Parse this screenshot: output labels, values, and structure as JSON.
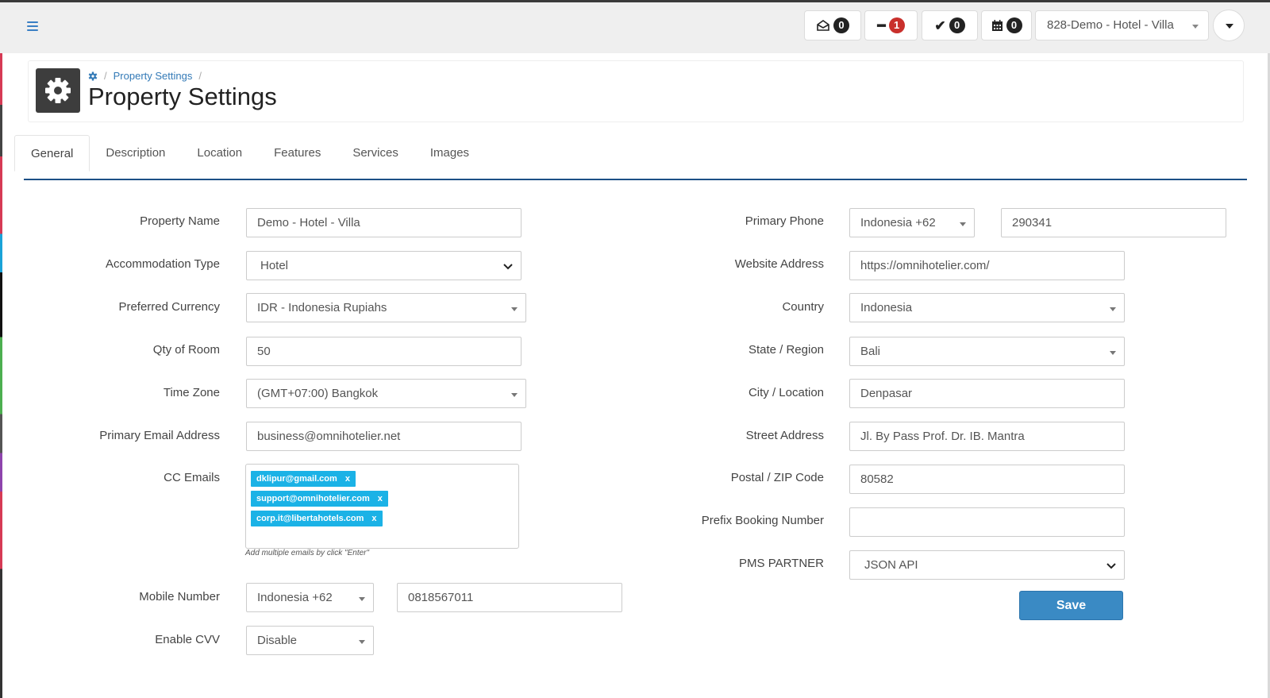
{
  "topbar": {
    "messages_count": "0",
    "minus_count": "1",
    "check_count": "0",
    "calendar_count": "0",
    "property_selector": "828-Demo - Hotel - Villa"
  },
  "breadcrumb": {
    "item": "Property Settings"
  },
  "page": {
    "title": "Property Settings"
  },
  "tabs": [
    "General",
    "Description",
    "Location",
    "Features",
    "Services",
    "Images"
  ],
  "left_form": {
    "property_name": {
      "label": "Property Name",
      "value": "Demo - Hotel - Villa"
    },
    "accommodation_type": {
      "label": "Accommodation Type",
      "value": "Hotel"
    },
    "preferred_currency": {
      "label": "Preferred Currency",
      "value": "IDR - Indonesia Rupiahs"
    },
    "qty_of_room": {
      "label": "Qty of Room",
      "value": "50"
    },
    "time_zone": {
      "label": "Time Zone",
      "value": "(GMT+07:00) Bangkok"
    },
    "primary_email": {
      "label": "Primary Email Address",
      "value": "business@omnihotelier.net"
    },
    "cc_emails": {
      "label": "CC Emails",
      "tags": [
        "dklipur@gmail.com",
        "support@omnihotelier.com",
        "corp.it@libertahotels.com"
      ],
      "remove": "x",
      "hint": "Add multiple emails by click \"Enter\""
    },
    "mobile_number": {
      "label": "Mobile Number",
      "country": "Indonesia +62",
      "value": "0818567011"
    },
    "enable_cvv": {
      "label": "Enable CVV",
      "value": "Disable"
    }
  },
  "right_form": {
    "primary_phone": {
      "label": "Primary Phone",
      "country": "Indonesia +62",
      "value": "290341"
    },
    "website": {
      "label": "Website Address",
      "value": "https://omnihotelier.com/"
    },
    "country": {
      "label": "Country",
      "value": "Indonesia"
    },
    "state": {
      "label": "State / Region",
      "value": "Bali"
    },
    "city": {
      "label": "City / Location",
      "value": "Denpasar"
    },
    "street": {
      "label": "Street Address",
      "value": "Jl. By Pass Prof. Dr. IB. Mantra"
    },
    "postal": {
      "label": "Postal / ZIP Code",
      "value": "80582"
    },
    "prefix_booking": {
      "label": "Prefix Booking Number",
      "value": ""
    },
    "pms_partner": {
      "label": "PMS PARTNER",
      "value": "JSON API"
    }
  },
  "actions": {
    "save": "Save"
  },
  "colors": {
    "accent": "#3a8ac4",
    "tag": "#1bb2e6",
    "tab_underline": "#1c4f86",
    "badge_alert": "#c9302c"
  },
  "icons": [
    "hamburger-menu-icon",
    "envelope-icon",
    "minus-icon",
    "check-icon",
    "calendar-icon",
    "gear-icon",
    "chevron-down-icon"
  ]
}
